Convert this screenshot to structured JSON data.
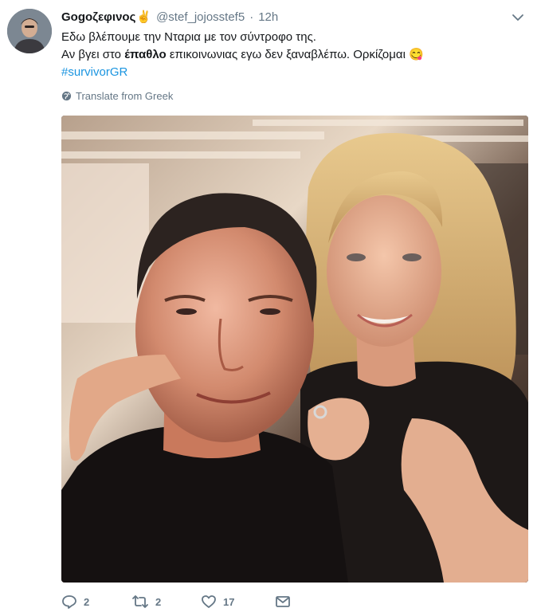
{
  "tweet": {
    "display_name": "Gogoζεφινος",
    "name_emoji": "✌",
    "handle": "@stef_jojosstef5",
    "separator": "·",
    "time": "12h",
    "text": {
      "line1": "Εδω βλέπουμε την Νταρια με τον σύντροφο της.",
      "line2_before": "Αν βγει στο ",
      "line2_bold": "έπαθλο",
      "line2_after": " επικοινωνιας εγω δεν ξαναβλέπω. Ορκίζομαι ",
      "line2_emoji": "😋",
      "hashtag": "#survivorGR"
    },
    "translate_label": "Translate from Greek",
    "icons": {
      "avatar": "avatar",
      "caret": "chevron-down-icon",
      "globe": "globe-icon",
      "reply": "reply-icon",
      "retweet": "retweet-icon",
      "like": "heart-icon",
      "dm": "envelope-icon"
    },
    "counts": {
      "replies": "2",
      "retweets": "2",
      "likes": "17"
    },
    "colors": {
      "name": "#14171a",
      "secondary": "#657786",
      "link": "#1b95e0"
    }
  }
}
